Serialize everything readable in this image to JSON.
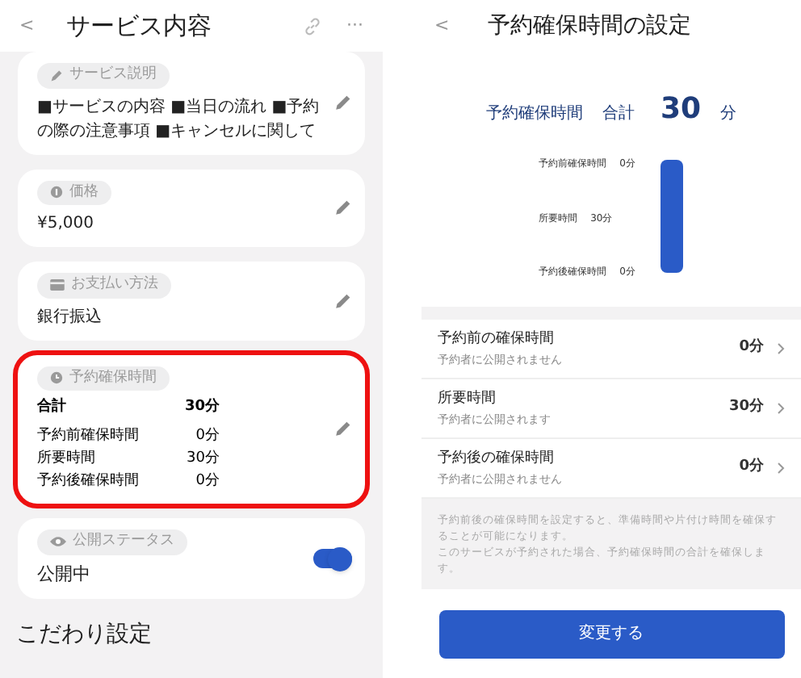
{
  "left": {
    "back": "<",
    "title": "サービス内容",
    "more": "···",
    "cards": [
      {
        "kind": "text",
        "tag": "サービス説明",
        "value": "■サービスの内容 ■当日の流れ ■予約の際の注意事項 ■キャンセルに関して",
        "highlighted": false
      },
      {
        "kind": "text",
        "tag": "価格",
        "value": "¥5,000",
        "highlighted": false
      },
      {
        "kind": "text",
        "tag": "お支払い方法",
        "value": "銀行振込",
        "highlighted": false
      },
      {
        "kind": "times",
        "tag": "予約確保時間",
        "highlighted": true,
        "rows": [
          {
            "label": "合計",
            "value": "30分",
            "total": true
          },
          {
            "label": "予約前確保時間",
            "value": "0分",
            "total": false
          },
          {
            "label": "所要時間",
            "value": "30分",
            "total": false
          },
          {
            "label": "予約後確保時間",
            "value": "0分",
            "total": false
          }
        ]
      },
      {
        "kind": "toggle",
        "tag": "公開ステータス",
        "value": "公開中",
        "on": true,
        "highlighted": false
      }
    ],
    "section_heading": "こだわり設定"
  },
  "right": {
    "back": "<",
    "title": "予約確保時間の設定",
    "summary": {
      "label": "予約確保時間",
      "total_label": "合計",
      "total": "30",
      "unit": "分",
      "breakdown": [
        {
          "label": "予約前確保時間",
          "value": "0分"
        },
        {
          "label": "所要時間",
          "value": "30分"
        },
        {
          "label": "予約後確保時間",
          "value": "0分"
        }
      ]
    },
    "rows": [
      {
        "title": "予約前の確保時間",
        "subtitle": "予約者に公開されません",
        "value": "0分"
      },
      {
        "title": "所要時間",
        "subtitle": "予約者に公開されます",
        "value": "30分"
      },
      {
        "title": "予約後の確保時間",
        "subtitle": "予約者に公開されません",
        "value": "0分"
      }
    ],
    "notes": [
      "予約前後の確保時間を設定すると、準備時間や片付け時間を確保することが可能になります。",
      "このサービスが予約された場合、予約確保時間の合計を確保します。"
    ],
    "button": "変更する"
  }
}
